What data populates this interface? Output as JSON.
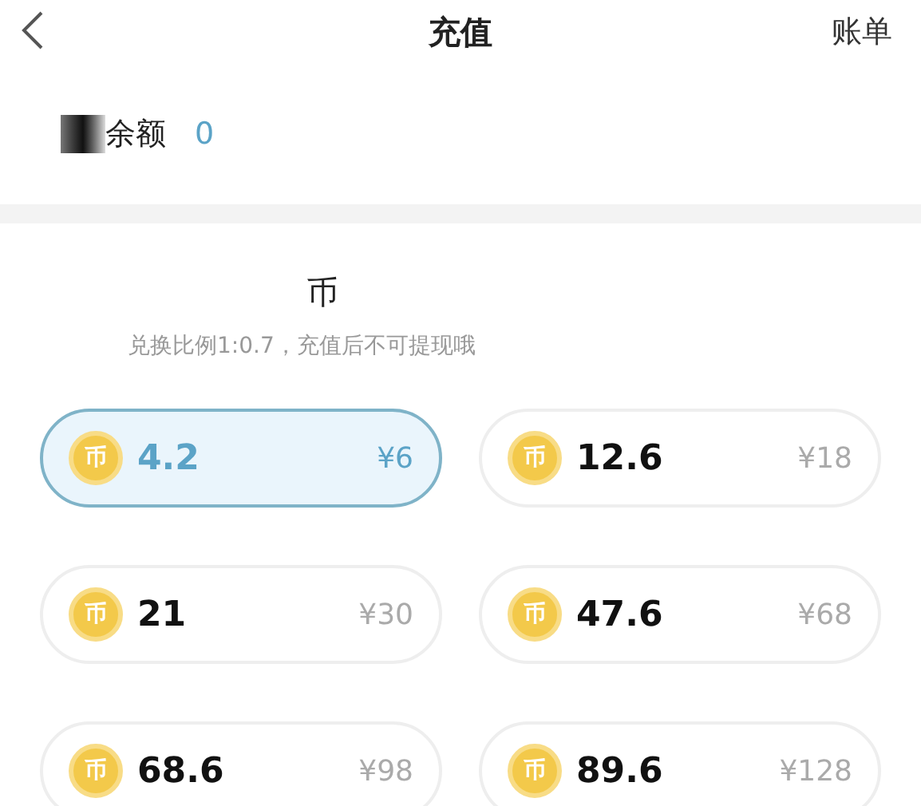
{
  "header": {
    "title": "充值",
    "bill_link": "账单"
  },
  "balance": {
    "label": "余额",
    "value": "0"
  },
  "card": {
    "title": "币",
    "note": "兑换比例1:0.7，充值后不可提现哦"
  },
  "options": [
    {
      "coin_glyph": "币",
      "amount": "4.2",
      "price": "¥6",
      "selected": true
    },
    {
      "coin_glyph": "币",
      "amount": "12.6",
      "price": "¥18",
      "selected": false
    },
    {
      "coin_glyph": "币",
      "amount": "21",
      "price": "¥30",
      "selected": false
    },
    {
      "coin_glyph": "币",
      "amount": "47.6",
      "price": "¥68",
      "selected": false
    },
    {
      "coin_glyph": "币",
      "amount": "68.6",
      "price": "¥98",
      "selected": false
    },
    {
      "coin_glyph": "币",
      "amount": "89.6",
      "price": "¥128",
      "selected": false
    }
  ]
}
